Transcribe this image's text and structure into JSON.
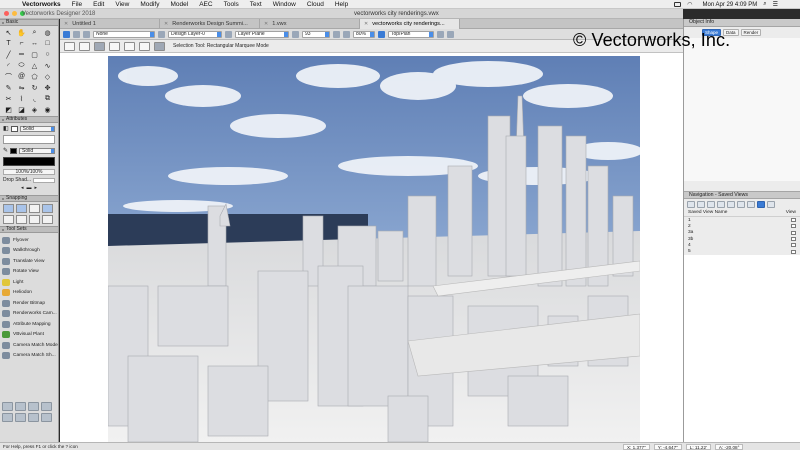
{
  "menubar": {
    "items": [
      "Vectorworks",
      "File",
      "Edit",
      "View",
      "Modify",
      "Model",
      "AEC",
      "Tools",
      "Text",
      "Window",
      "Cloud",
      "Help"
    ],
    "clock": "Mon Apr 29  4:09 PM"
  },
  "window": {
    "app_title": "Vectorworks Designer 2018",
    "document_title": "vectorworks city renderings.vwx"
  },
  "tabs": [
    {
      "label": "Untitled 1",
      "active": false
    },
    {
      "label": "Renderworks Design Summi...",
      "active": false
    },
    {
      "label": "1.vwx",
      "active": false
    },
    {
      "label": "vectorworks city renderings...",
      "active": true
    }
  ],
  "viewbar": {
    "class_value": "None",
    "layer_value": "Design Layer-0",
    "plane_value": "Layer Plane",
    "view_value": "Top/Plan",
    "zoom_value": "80%",
    "ratio_value": "93"
  },
  "modebar": {
    "hint": "Selection Tool: Rectangular Marquee Mode"
  },
  "palettes": {
    "basic_label": "Basic",
    "attributes_label": "Attributes",
    "fill_label": "Solid",
    "pen_label": "Solid",
    "opacity_label": "100%/100%",
    "drop_shadow_label": "Drop Shad...",
    "snapping_label": "Snapping",
    "tool_sets_label": "Tool Sets"
  },
  "tool_sets": [
    "Flyover",
    "Walkthrough",
    "Translate View",
    "Rotate View",
    "Light",
    "Heliodon",
    "Render Bitmap",
    "Renderworks Cam...",
    "Attribute Mapping",
    "VBvisual Plant",
    "Camera Match Mode",
    "Camera Match Sh..."
  ],
  "object_info": {
    "title": "Object Info",
    "tabs": [
      "Shape",
      "Data",
      "Render"
    ]
  },
  "navigation": {
    "title": "Navigation - Saved Views",
    "col_name": "Saved View Name",
    "col_view": "View",
    "rows": [
      "1",
      "2",
      "3a",
      "3b",
      "4",
      "5"
    ]
  },
  "status": {
    "hint": "For Help, press F1 or click the ? icon",
    "x": "X: 1.377\"",
    "y": "Y: -4.647\"",
    "l": "L: 11.22'",
    "a": "A: -20.08°"
  },
  "watermark": "© Vectorworks, Inc.",
  "colors": {
    "accent": "#3a7bd5",
    "sky": "#6f8fc2",
    "water": "#2c3c58"
  }
}
